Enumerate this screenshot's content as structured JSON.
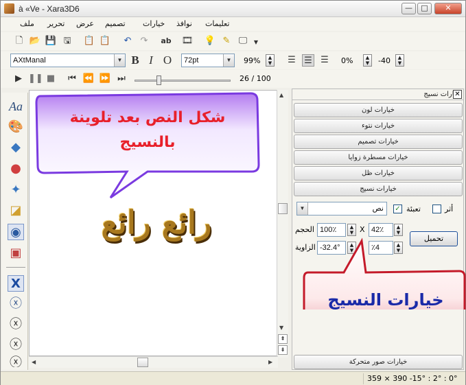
{
  "window": {
    "title": "à «Ve - Xara3D6"
  },
  "menu": [
    "ملف",
    "تحرير",
    "عرض",
    "تصميم",
    "خيارات",
    "نوافذ",
    "تعليمات"
  ],
  "font_toolbar": {
    "font_name": "AXtManal",
    "bold": "B",
    "italic": "I",
    "outline": "O",
    "font_size": "72pt",
    "zoom": "99%",
    "spacing": "0%",
    "line_spacing": "-40"
  },
  "playback": {
    "frame": "26 / 100"
  },
  "canvas": {
    "callout_text": "شكل النص بعد تلوينة بالنسيج",
    "sample_text": "رائع رائع"
  },
  "panel": {
    "header": "خيارات نسيج",
    "sections_top": [
      "خيارات لون",
      "خيارات نتوء",
      "خيارات تصميم",
      "خيارات مسطرة زوايا",
      "خيارات ظل",
      "خيارات نسيج"
    ],
    "texture_target": "نص",
    "fill_label": "تعبئة",
    "fill_checked": true,
    "trace_label": "أثر",
    "size_label": "الحجم",
    "size_x": "100٪",
    "size_y": "42٪",
    "times": "X",
    "angle_label": "الزاوية",
    "angle": "-32.4°",
    "angle_extra": "٪4",
    "load_button": "تحميل",
    "section_bottom": "خيارات صور متحركة",
    "callout_text": "خيارات النسيج"
  },
  "status": {
    "coords": "359 × 390  -15° : 2° : 0°"
  }
}
